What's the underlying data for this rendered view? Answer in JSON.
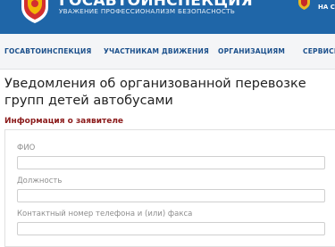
{
  "header": {
    "title": "ГОСАВТОИНСПЕКЦИЯ",
    "subtitle": "УВАЖЕНИЕ ПРОФЕССИОНАЛИЗМ БЕЗОПАСНОСТЬ",
    "right_label": "НА С",
    "background": "#1f66a8",
    "emblem_icon": "gibdd-shield-emblem",
    "right_icon": "russian-coat-of-arms"
  },
  "nav": {
    "items": [
      {
        "label": "ГОСАВТОИНСПЕКЦИЯ"
      },
      {
        "label": "УЧАСТНИКАМ ДВИЖЕНИЯ"
      },
      {
        "label": "ОРГАНИЗАЦИЯМ"
      },
      {
        "label": "СЕРВИСЫ"
      }
    ]
  },
  "main": {
    "title": "Уведомления об организованной перевозке групп детей автобусами",
    "section_heading": "Информация о заявителе",
    "fields": [
      {
        "label": "ФИО",
        "value": "",
        "placeholder": ""
      },
      {
        "label": "Должность",
        "value": "",
        "placeholder": ""
      },
      {
        "label": "Контактный номер телефона и (или) факса",
        "value": "",
        "placeholder": ""
      }
    ]
  },
  "colors": {
    "nav_text": "#1a4f8b",
    "section_heading": "#8b1a1a"
  }
}
